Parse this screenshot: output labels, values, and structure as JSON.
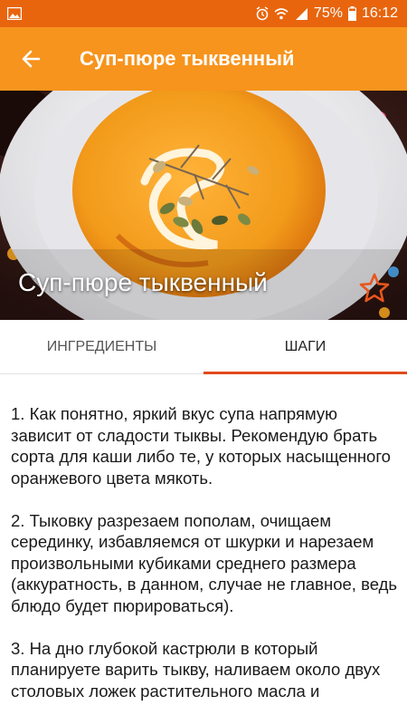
{
  "status_bar": {
    "battery": "75%",
    "time": "16:12",
    "icons": [
      "image-icon",
      "alarm-icon",
      "wifi-icon",
      "signal-icon",
      "battery-icon"
    ]
  },
  "app_bar": {
    "title": "Суп-пюре тыквенный",
    "back_icon": "arrow-left-icon"
  },
  "hero": {
    "title": "Суп-пюре тыквенный",
    "favorite_icon": "star-outline-icon"
  },
  "tabs": [
    {
      "label": "ИНГРЕДИЕНТЫ",
      "active": false
    },
    {
      "label": "ШАГИ",
      "active": true
    }
  ],
  "steps": [
    "1. Как понятно, яркий вкус супа напрямую зависит от сладости тыквы. Рекомендую брать сорта для каши либо те, у которых насыщенного оранжевого цвета мякоть.",
    "2. Тыковку разрезаем пополам, очищаем серединку, избавляемся от шкурки и нарезаем произвольными кубиками среднего размера (аккуратность, в данном, случае не главное, ведь блюдо будет пюрироваться).",
    "3. На дно глубокой кастрюли в который планируете варить тыкву, наливаем около двух столовых ложек растительного масла и"
  ],
  "colors": {
    "status_bar": "#e8650e",
    "app_bar": "#f7941d",
    "tab_indicator": "#e04a1c",
    "favorite_star": "#e8561c"
  }
}
